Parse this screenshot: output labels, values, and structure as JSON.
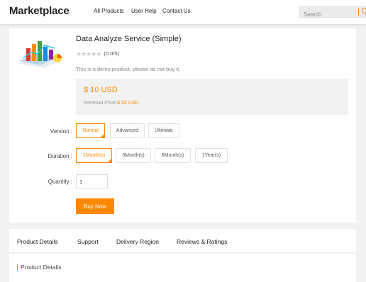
{
  "header": {
    "brand": "Marketplace",
    "nav": [
      "All Products",
      "User Help",
      "Contact Us"
    ],
    "search_placeholder": "Search",
    "accent": "#ff8800"
  },
  "product": {
    "title": "Data Analyze Service (Simple)",
    "rating_text": "(0.0/5)",
    "rating_value": 0,
    "description": "This is a demo product, please do not buy it.",
    "price": "$ 10 USD",
    "renewal_label": "Renewal Price:",
    "renewal_value": "$ 20 USD"
  },
  "options": {
    "version_label": "Version :",
    "versions": [
      "Normal",
      "Advanced",
      "Ultimate"
    ],
    "version_selected": "Normal",
    "duration_label": "Duration :",
    "durations": [
      "1Month(s)",
      "3Month(s)",
      "6Month(s)",
      "1Year(s)"
    ],
    "duration_selected": "1Month(s)",
    "quantity_label": "Quantity :",
    "quantity": "1",
    "buy_label": "Buy Now"
  },
  "tabs": [
    "Product Details",
    "Support",
    "Delivery Region",
    "Reviews & Ratings"
  ],
  "section_title": "Product Details"
}
